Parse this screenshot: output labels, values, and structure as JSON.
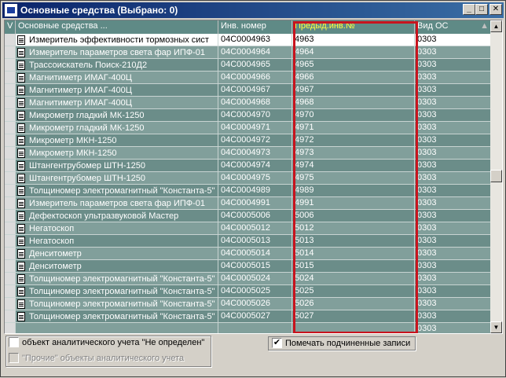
{
  "window": {
    "title": "Основные средства  (Выбрано: 0)",
    "minimize": "_",
    "maximize": "□",
    "close": "✕"
  },
  "grid": {
    "columns": {
      "v": "V",
      "name": "Основные средства ...",
      "inv": "Инв. номер",
      "prev": "Предыд.инв.№",
      "vid": "Вид ОС"
    },
    "sort_indicator": "▲",
    "rows": [
      {
        "name": "Измеритель эффективности тормозных сист",
        "inv": "04C0004963",
        "prev": "4963",
        "vid": "0303"
      },
      {
        "name": "Измеритель параметров света фар ИПФ-01",
        "inv": "04C0004964",
        "prev": "4964",
        "vid": "0303"
      },
      {
        "name": "Трассоискатель Поиск-210Д2",
        "inv": "04C0004965",
        "prev": "4965",
        "vid": "0303"
      },
      {
        "name": "Магнитиметр ИМАГ-400Ц",
        "inv": "04C0004966",
        "prev": "4966",
        "vid": "0303"
      },
      {
        "name": "Магнитиметр ИМАГ-400Ц",
        "inv": "04C0004967",
        "prev": "4967",
        "vid": "0303"
      },
      {
        "name": "Магнитиметр ИМАГ-400Ц",
        "inv": "04C0004968",
        "prev": "4968",
        "vid": "0303"
      },
      {
        "name": "Микрометр гладкий МК-1250",
        "inv": "04C0004970",
        "prev": "4970",
        "vid": "0303"
      },
      {
        "name": "Микрометр гладкий МК-1250",
        "inv": "04C0004971",
        "prev": "4971",
        "vid": "0303"
      },
      {
        "name": "Микрометр МКН-1250",
        "inv": "04C0004972",
        "prev": "4972",
        "vid": "0303"
      },
      {
        "name": "Микрометр МКН-1250",
        "inv": "04C0004973",
        "prev": "4973",
        "vid": "0303"
      },
      {
        "name": "Штангентрубомер ШТН-1250",
        "inv": "04C0004974",
        "prev": "4974",
        "vid": "0303"
      },
      {
        "name": "Штангентрубомер ШТН-1250",
        "inv": "04C0004975",
        "prev": "4975",
        "vid": "0303"
      },
      {
        "name": "Толщиномер электромагнитный \"Константа-5\"",
        "inv": "04C0004989",
        "prev": "4989",
        "vid": "0303"
      },
      {
        "name": "Измеритель параметров света фар ИПФ-01",
        "inv": "04C0004991",
        "prev": "4991",
        "vid": "0303"
      },
      {
        "name": "Дефектоскоп ультразвуковой Мастер",
        "inv": "04C0005006",
        "prev": "5006",
        "vid": "0303"
      },
      {
        "name": "Негатоскоп",
        "inv": "04C0005012",
        "prev": "5012",
        "vid": "0303"
      },
      {
        "name": "Негатоскоп",
        "inv": "04C0005013",
        "prev": "5013",
        "vid": "0303"
      },
      {
        "name": "Денситометр",
        "inv": "04C0005014",
        "prev": "5014",
        "vid": "0303"
      },
      {
        "name": "Денситометр",
        "inv": "04C0005015",
        "prev": "5015",
        "vid": "0303"
      },
      {
        "name": "Толщиномер электромагнитный \"Константа-5\"",
        "inv": "04C0005024",
        "prev": "5024",
        "vid": "0303"
      },
      {
        "name": "Толщиномер электромагнитный \"Константа-5\"",
        "inv": "04C0005025",
        "prev": "5025",
        "vid": "0303"
      },
      {
        "name": "Толщиномер электромагнитный \"Константа-5\"",
        "inv": "04C0005026",
        "prev": "5026",
        "vid": "0303"
      },
      {
        "name": "Толщиномер электромагнитный \"Константа-5\"",
        "inv": "04C0005027",
        "prev": "5027",
        "vid": "0303"
      },
      {
        "name": "",
        "inv": "",
        "prev": "",
        "vid": "0303"
      }
    ]
  },
  "options": {
    "undefined_object": {
      "label": "объект аналитического учета \"Не определен\"",
      "checked": false
    },
    "other_objects": {
      "label": "\"Прочие\" объекты аналитического учета",
      "checked": false
    },
    "mark_children": {
      "label": "Помечать подчиненные записи",
      "checked": true
    }
  },
  "colors": {
    "titlebar": "#0a246a",
    "header": "#5f8a86",
    "highlight_frame": "#c8141e",
    "prev_header_text": "#ffff40"
  },
  "icons": {
    "row_icon": "document-icon",
    "checkmark": "✔"
  }
}
